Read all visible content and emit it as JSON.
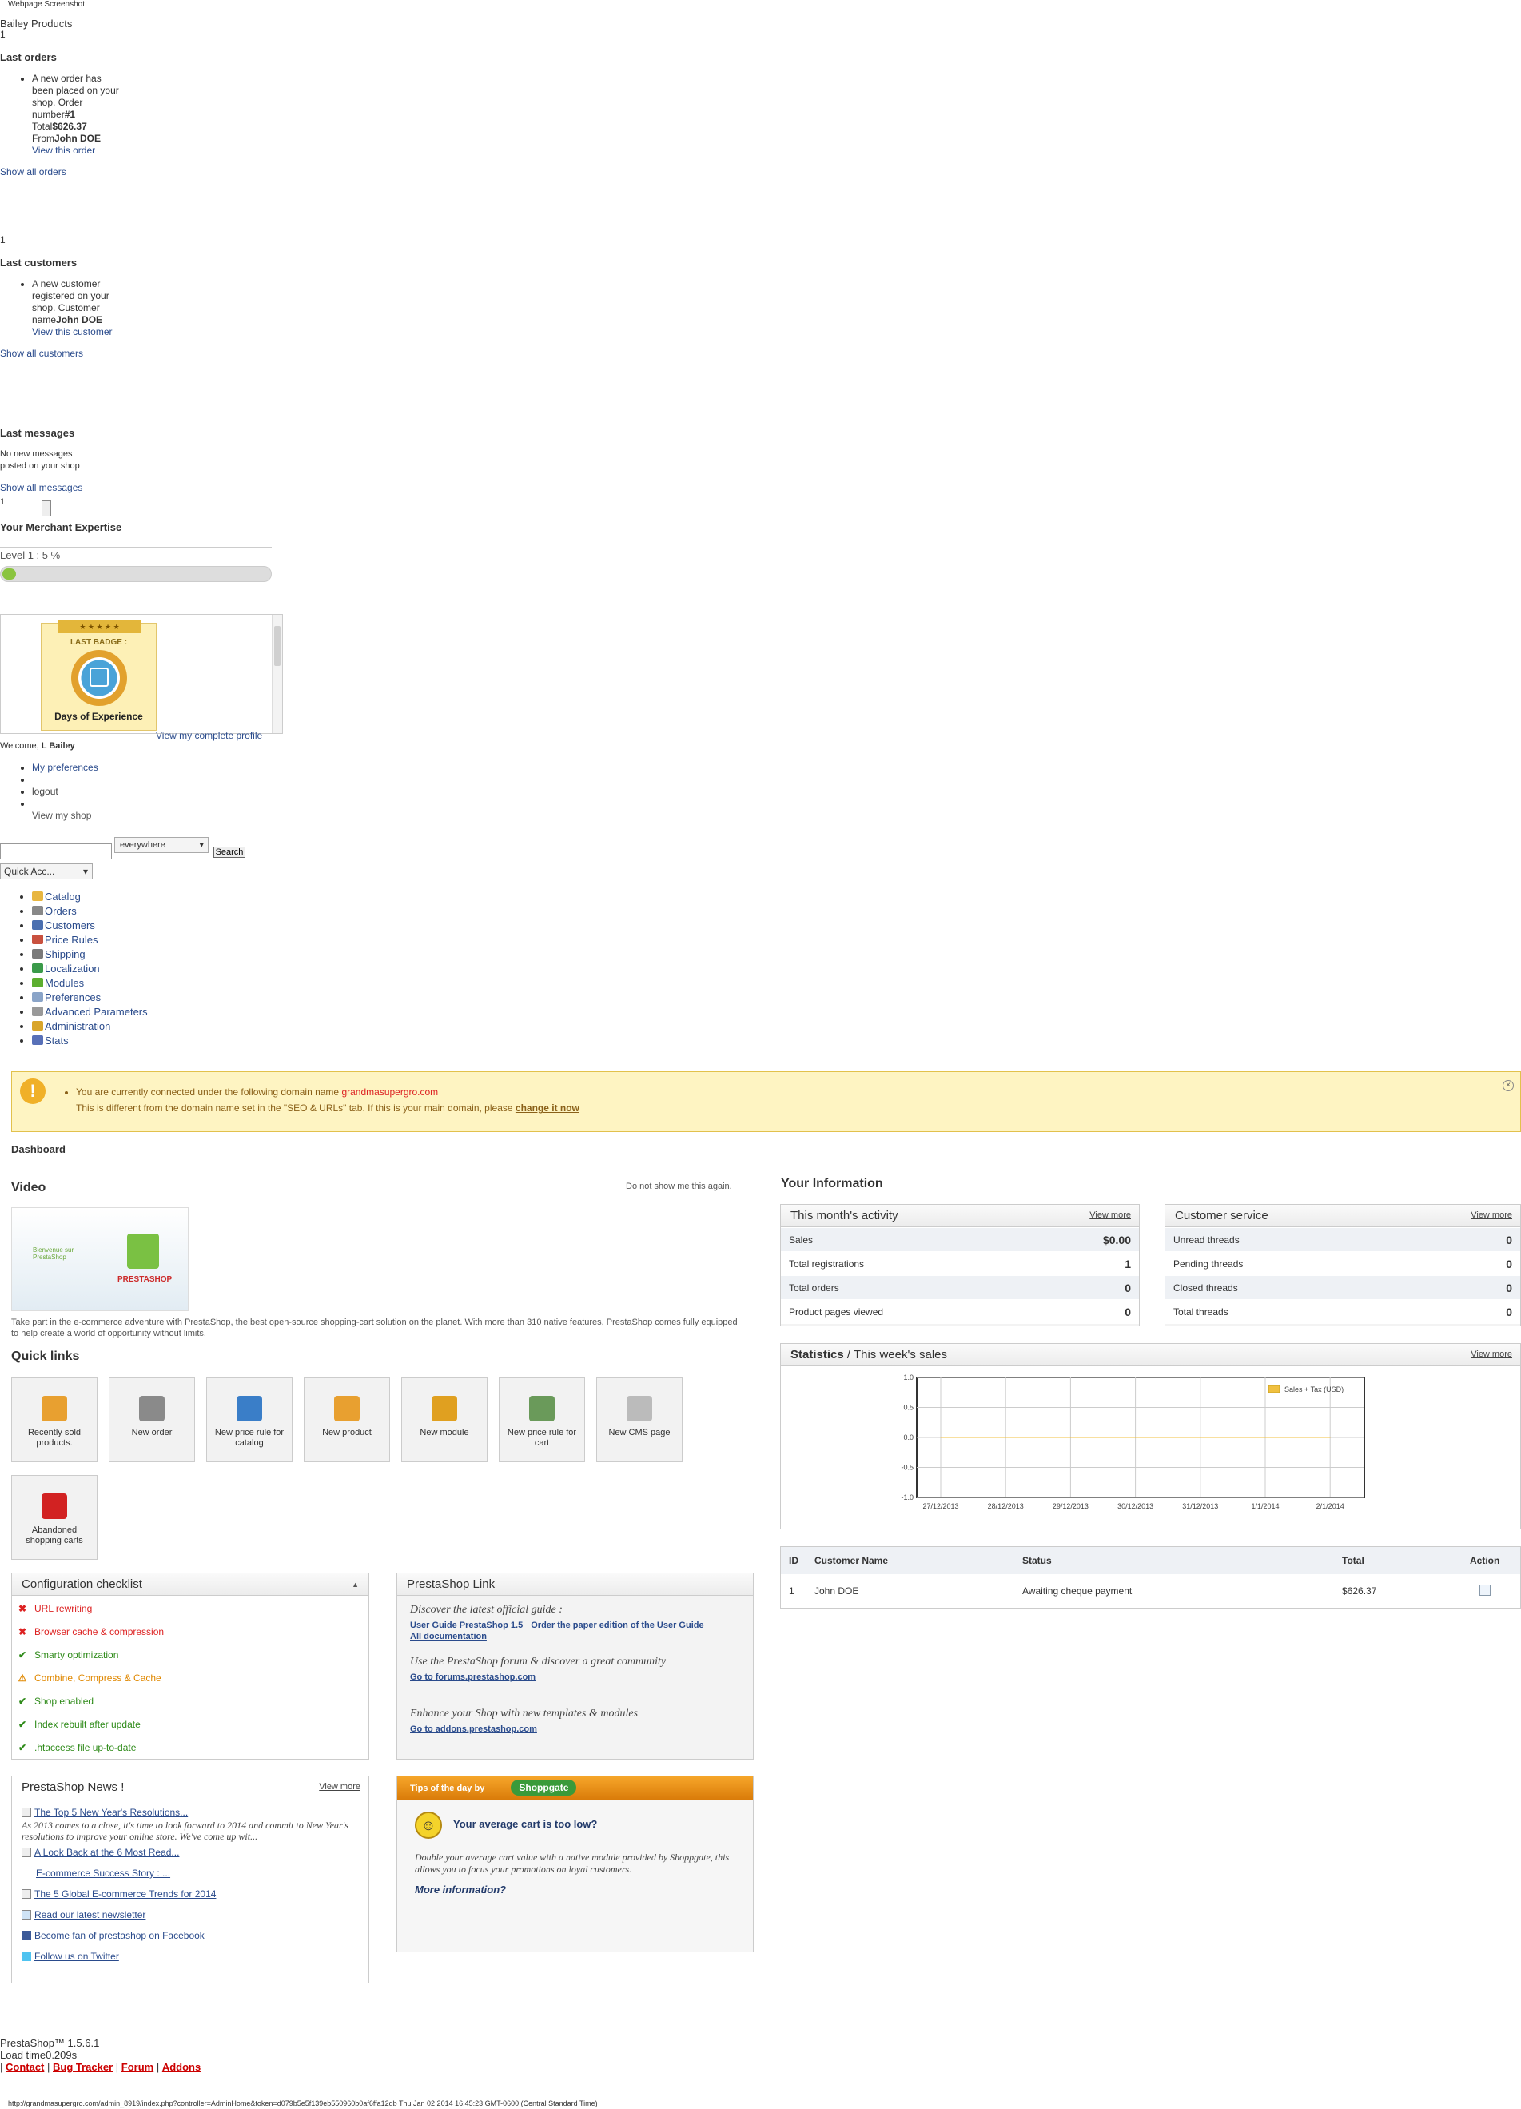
{
  "window_title": "Webpage Screenshot",
  "shop_name": "Bailey Products",
  "orders": {
    "count": "1",
    "title": "Last orders",
    "item": {
      "l1": "A new order has been placed on your shop.",
      "l2": "Order number",
      "num": "#1",
      "l3": "Total",
      "total": "$626.37",
      "l4": "From",
      "from": "John DOE",
      "link": "View this order"
    },
    "show_all": "Show all orders"
  },
  "customers": {
    "count": "1",
    "title": "Last customers",
    "item": {
      "l1": "A new customer registered on your shop.",
      "l2": "Customer name",
      "name": "John DOE",
      "link": "View this customer"
    },
    "show_all": "Show all customers"
  },
  "messages": {
    "title": "Last messages",
    "empty": "No new messages posted on your shop",
    "show_all": "Show all messages"
  },
  "merchant": {
    "count": "1",
    "title": "Your Merchant Expertise",
    "level": "Level 1 : 5 %",
    "progress": 0.05,
    "badge_label": "LAST BADGE :",
    "badge_name": "Days of Experience",
    "profile_link": "View my complete profile"
  },
  "user": {
    "welcome": "Welcome,",
    "name": "L Bailey",
    "menu": [
      "My preferences",
      "logout",
      "View my shop"
    ]
  },
  "search": {
    "scope": "everywhere",
    "button": "Search",
    "quick_access": "Quick Acc..."
  },
  "nav": [
    {
      "label": "Catalog",
      "icon": "folder-icon",
      "color": "#e8b640"
    },
    {
      "label": "Orders",
      "icon": "cart-icon",
      "color": "#888888"
    },
    {
      "label": "Customers",
      "icon": "user-icon",
      "color": "#4a6fb0"
    },
    {
      "label": "Price Rules",
      "icon": "price-rule-icon",
      "color": "#c9513f"
    },
    {
      "label": "Shipping",
      "icon": "truck-icon",
      "color": "#7a7a7a"
    },
    {
      "label": "Localization",
      "icon": "globe-icon",
      "color": "#3a9a4a"
    },
    {
      "label": "Modules",
      "icon": "puzzle-icon",
      "color": "#5cae2f"
    },
    {
      "label": "Preferences",
      "icon": "preferences-icon",
      "color": "#8aa4c8"
    },
    {
      "label": "Advanced Parameters",
      "icon": "wrench-icon",
      "color": "#999999"
    },
    {
      "label": "Administration",
      "icon": "key-icon",
      "color": "#d9a52a"
    },
    {
      "label": "Stats",
      "icon": "stats-icon",
      "color": "#5870b8"
    }
  ],
  "warning": {
    "l1": "You are currently connected under the following domain name",
    "domain": "grandmasupergro.com",
    "l2": "This is different from the domain name set in the \"SEO & URLs\" tab. If this is your main domain, please",
    "action": "change it now"
  },
  "dashboard": {
    "title": "Dashboard"
  },
  "video": {
    "title": "Video",
    "optout": "Do not show me this again.",
    "desc": "Take part in the e-commerce adventure with PrestaShop, the best open-source shopping-cart solution on the planet. With more than 310 native features, PrestaShop comes fully equipped to help create a world of opportunity without limits.",
    "thumb_brand": "PRESTASHOP",
    "thumb_text": "Bienvenue sur PrestaShop"
  },
  "quick_links": {
    "title": "Quick links",
    "items": [
      {
        "label": "Recently sold products.",
        "icon": "products-icon",
        "color": "#e8a030"
      },
      {
        "label": "New order",
        "icon": "new-order-icon",
        "color": "#8a8a8a"
      },
      {
        "label": "New price rule for catalog",
        "icon": "price-catalog-icon",
        "color": "#3a7ec8"
      },
      {
        "label": "New product",
        "icon": "new-product-icon",
        "color": "#e8a030"
      },
      {
        "label": "New module",
        "icon": "new-module-icon",
        "color": "#e0a020"
      },
      {
        "label": "New price rule for cart",
        "icon": "price-cart-icon",
        "color": "#6a9a5a"
      },
      {
        "label": "New CMS page",
        "icon": "cms-page-icon",
        "color": "#bbbbbb"
      },
      {
        "label": "Abandoned shopping carts",
        "icon": "abandoned-cart-icon",
        "color": "#d22222"
      }
    ]
  },
  "checklist": {
    "title": "Configuration checklist",
    "items": [
      {
        "label": "URL rewriting",
        "status": "bad",
        "mark": "✖"
      },
      {
        "label": "Browser cache & compression",
        "status": "bad",
        "mark": "✖"
      },
      {
        "label": "Smarty optimization",
        "status": "good",
        "mark": "✔"
      },
      {
        "label": "Combine, Compress & Cache",
        "status": "mid",
        "mark": "⚠"
      },
      {
        "label": "Shop enabled",
        "status": "good",
        "mark": "✔"
      },
      {
        "label": "Index rebuilt after update",
        "status": "good",
        "mark": "✔"
      },
      {
        "label": ".htaccess file up-to-date",
        "status": "good",
        "mark": "✔"
      }
    ]
  },
  "pslink": {
    "title": "PrestaShop Link",
    "guide_text": "Discover the latest official guide :",
    "guide1": "User Guide PrestaShop 1.5",
    "guide2": "Order the paper edition of the User Guide",
    "guide3": "All documentation",
    "forum_text": "Use the PrestaShop forum & discover a great community",
    "forum_link": "Go to forums.prestashop.com",
    "addons_text": "Enhance your Shop with new templates & modules",
    "addons_link": "Go to addons.prestashop.com"
  },
  "news": {
    "title": "PrestaShop News !",
    "view_more": "View more",
    "items": [
      "The Top 5 New Year's Resolutions...",
      "A Look Back at the 6 Most Read...",
      "E-commerce Success Story : ...",
      "The 5 Global E-commerce Trends for 2014",
      "Read our latest newsletter",
      "Become fan of prestashop on Facebook",
      "Follow us on Twitter"
    ],
    "excerpt": "As 2013 comes to a close, it's time to look forward to 2014 and commit to New Year's resolutions to improve your online store. We've come up wit..."
  },
  "tips": {
    "title": "Tips of the day by",
    "brand": "Shoppgate",
    "headline": "Your average cart is too low?",
    "body": "Double your average cart value with a native module provided by Shoppgate, this allows you to focus your promotions on loyal customers.",
    "more": "More information?"
  },
  "info": {
    "title": "Your Information",
    "activity": {
      "title": "This month's activity",
      "view_more": "View more",
      "rows": [
        {
          "label": "Sales",
          "value": "$0.00"
        },
        {
          "label": "Total registrations",
          "value": "1"
        },
        {
          "label": "Total orders",
          "value": "0"
        },
        {
          "label": "Product pages viewed",
          "value": "0"
        }
      ]
    },
    "service": {
      "title": "Customer service",
      "view_more": "View more",
      "rows": [
        {
          "label": "Unread threads",
          "value": "0"
        },
        {
          "label": "Pending threads",
          "value": "0"
        },
        {
          "label": "Closed threads",
          "value": "0"
        },
        {
          "label": "Total threads",
          "value": "0"
        }
      ]
    }
  },
  "stats": {
    "title": "Statistics",
    "subtitle": "/ This week's sales",
    "view_more": "View more"
  },
  "chart_data": {
    "type": "line",
    "title": "",
    "x": [
      "27/12/2013",
      "28/12/2013",
      "29/12/2013",
      "30/12/2013",
      "31/12/2013",
      "1/1/2014",
      "2/1/2014"
    ],
    "series": [
      {
        "name": "Sales + Tax (USD)",
        "values": [
          0,
          0,
          0,
          0,
          0,
          0,
          0
        ],
        "color": "#f0c040"
      }
    ],
    "ylim": [
      -1.0,
      1.0
    ],
    "yticks": [
      "1.0",
      "0.5",
      "0.0",
      "-0.5",
      "-1.0"
    ],
    "grid": true,
    "legend": "top-right"
  },
  "orders_table": {
    "headers": [
      "ID",
      "Customer Name",
      "Status",
      "Total",
      "Action"
    ],
    "rows": [
      {
        "id": "1",
        "name": "John DOE",
        "status": "Awaiting cheque payment",
        "total": "$626.37"
      }
    ]
  },
  "footer": {
    "version": "PrestaShop™ 1.5.6.1",
    "load": "Load time0.209s",
    "links": [
      "Contact",
      "Bug Tracker",
      "Forum",
      "Addons"
    ],
    "status_url": "http://grandmasupergro.com/admin_8919/index.php?controller=AdminHome&token=d079b5e5f139eb550960b0af6ffa12db Thu Jan 02 2014 16:45:23 GMT-0600 (Central Standard Time)"
  }
}
